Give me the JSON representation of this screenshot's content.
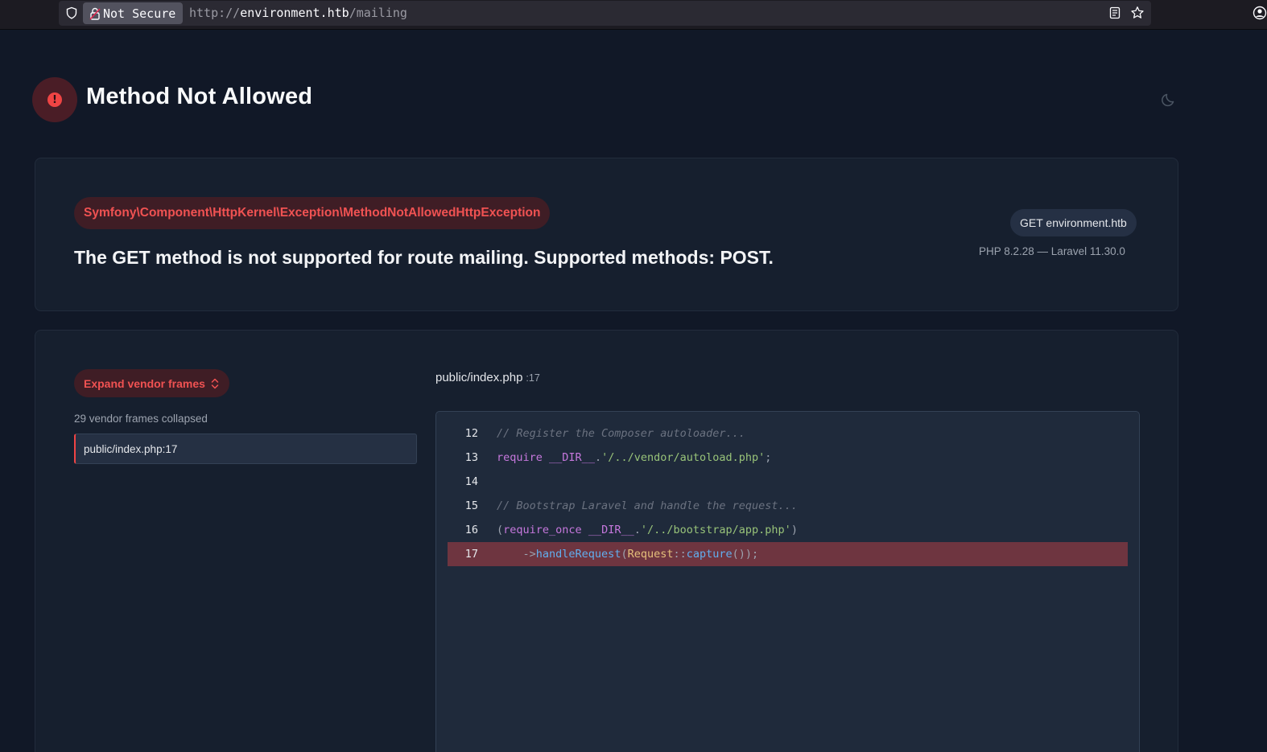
{
  "browser": {
    "security_label": "Not Secure",
    "url_scheme": "http://",
    "url_host": "environment.htb",
    "url_path": "/mailing"
  },
  "header": {
    "title": "Method Not Allowed",
    "badge_glyph": "!"
  },
  "exception": {
    "class": "Symfony\\Component\\HttpKernel\\Exception\\MethodNotAllowedHttpException",
    "message": "The GET method is not supported for route mailing. Supported methods: POST.",
    "request": "GET environment.htb",
    "versions": "PHP 8.2.28 — Laravel 11.30.0"
  },
  "frames": {
    "expand_label": "Expand vendor frames",
    "collapsed_text": "29 vendor frames collapsed",
    "items": [
      {
        "file": "public/index.php",
        "line": ":17"
      }
    ]
  },
  "source": {
    "file": "public/index.php",
    "line": ":17",
    "highlighted_line": 17,
    "lines": [
      {
        "num": "12",
        "tokens": [
          {
            "t": "// Register the Composer autoloader...",
            "k": "comment"
          }
        ]
      },
      {
        "num": "13",
        "tokens": [
          {
            "t": "require",
            "k": "kw"
          },
          {
            "t": " ",
            "k": "punc"
          },
          {
            "t": "__DIR__",
            "k": "kw"
          },
          {
            "t": ".",
            "k": "punc"
          },
          {
            "t": "'/../vendor/autoload.php'",
            "k": "str"
          },
          {
            "t": ";",
            "k": "punc"
          }
        ]
      },
      {
        "num": "14",
        "tokens": []
      },
      {
        "num": "15",
        "tokens": [
          {
            "t": "// Bootstrap Laravel and handle the request...",
            "k": "comment"
          }
        ]
      },
      {
        "num": "16",
        "tokens": [
          {
            "t": "(",
            "k": "punc"
          },
          {
            "t": "require_once",
            "k": "kw"
          },
          {
            "t": " ",
            "k": "punc"
          },
          {
            "t": "__DIR__",
            "k": "kw"
          },
          {
            "t": ".",
            "k": "punc"
          },
          {
            "t": "'/../bootstrap/app.php'",
            "k": "str"
          },
          {
            "t": ")",
            "k": "punc"
          }
        ]
      },
      {
        "num": "17",
        "tokens": [
          {
            "t": "    ->",
            "k": "punc"
          },
          {
            "t": "handleRequest",
            "k": "fn"
          },
          {
            "t": "(",
            "k": "punc"
          },
          {
            "t": "Request",
            "k": "cls"
          },
          {
            "t": "::",
            "k": "punc"
          },
          {
            "t": "capture",
            "k": "fn"
          },
          {
            "t": "());",
            "k": "punc"
          }
        ]
      }
    ]
  },
  "colors": {
    "background": "#111827",
    "card": "#161f2e",
    "accent_red": "#ef4444",
    "highlight_line": "#6e3540"
  },
  "icons": {
    "shield": "shield-icon",
    "lock": "lock-icon",
    "reader": "reader-view-icon",
    "star": "star-icon",
    "account": "account-icon",
    "alert": "alert-icon",
    "moon": "moon-icon",
    "chevrons": "chevron-up-down-icon"
  }
}
